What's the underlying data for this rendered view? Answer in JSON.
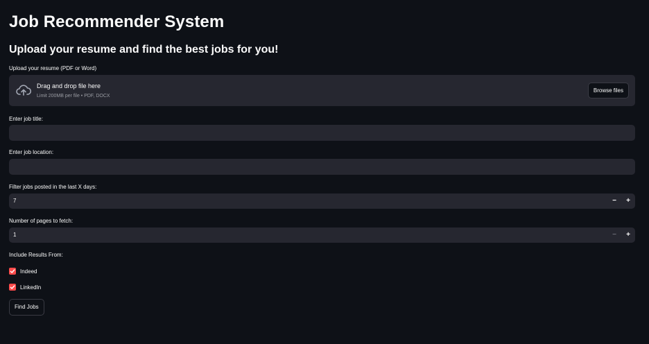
{
  "page": {
    "title": "Job Recommender System",
    "subtitle": "Upload your resume and find the best jobs for you!"
  },
  "uploader": {
    "label": "Upload your resume (PDF or Word)",
    "drag_text": "Drag and drop file here",
    "limit_text": "Limit 200MB per file • PDF, DOCX",
    "browse_label": "Browse files",
    "icon": "cloud-upload-icon"
  },
  "job_title": {
    "label": "Enter job title:",
    "value": "",
    "placeholder": ""
  },
  "job_location": {
    "label": "Enter job location:",
    "value": "",
    "placeholder": ""
  },
  "days_filter": {
    "label": "Filter jobs posted in the last X days:",
    "value": "7",
    "minus": "−",
    "plus": "+"
  },
  "pages": {
    "label": "Number of pages to fetch:",
    "value": "1",
    "minus": "−",
    "plus": "+"
  },
  "sources": {
    "label": "Include Results From:",
    "items": [
      {
        "label": "Indeed",
        "checked": true
      },
      {
        "label": "LinkedIn",
        "checked": true
      }
    ]
  },
  "actions": {
    "find_label": "Find Jobs"
  },
  "colors": {
    "background": "#0e1117",
    "input_bg": "#262730",
    "accent": "#ff4b4b",
    "text": "#fafafa"
  }
}
